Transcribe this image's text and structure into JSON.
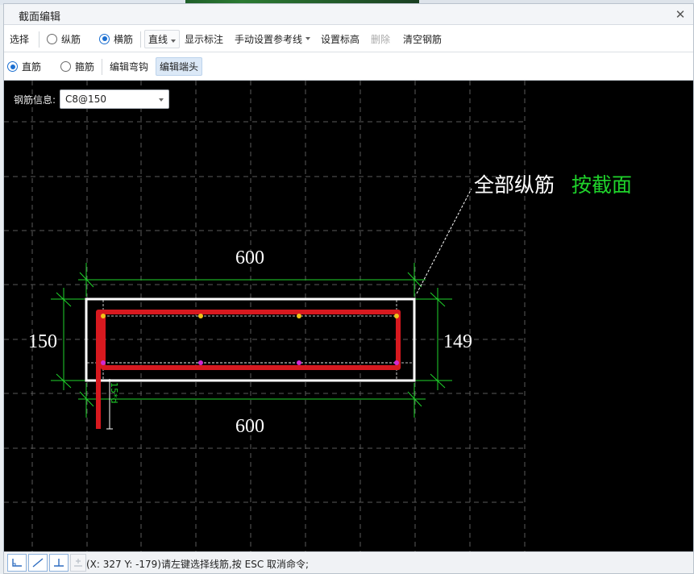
{
  "window": {
    "title": "截面编辑"
  },
  "toolbar1": {
    "select": "选择",
    "longitudinal": "纵筋",
    "transverse": "横筋",
    "line_mode": "直线",
    "show_dims": "显示标注",
    "ref_line": "手动设置参考线",
    "set_elevation": "设置标高",
    "delete": "删除",
    "clear": "清空钢筋"
  },
  "toolbar2": {
    "straight": "直筋",
    "stirrup": "箍筋",
    "edit_hook": "编辑弯钩",
    "edit_end": "编辑端头"
  },
  "rebar_info": {
    "label": "钢筋信息:",
    "value": "C8@150"
  },
  "drawing": {
    "dim_top": "600",
    "dim_bottom": "600",
    "dim_left": "150",
    "dim_right": "149",
    "annotation_white": "全部纵筋",
    "annotation_green": "按截面",
    "anchor_text": "15*d"
  },
  "colors": {
    "canvas_bg": "#000000",
    "rebar": "#d7191f",
    "dimension": "#1fd32b",
    "section_outline": "#ffffff",
    "grid": "#5a5a5a",
    "rebar_point_top": "#f0c419",
    "rebar_point_bottom": "#d12ad1",
    "accent": "#1b6fd1"
  },
  "status": {
    "message": "(X: 327 Y: -179)请左键选择线筋,按 ESC 取消命令;",
    "buttons": [
      "orthogonal-icon",
      "diagonal-icon",
      "perpendicular-icon",
      "extend-icon"
    ]
  }
}
